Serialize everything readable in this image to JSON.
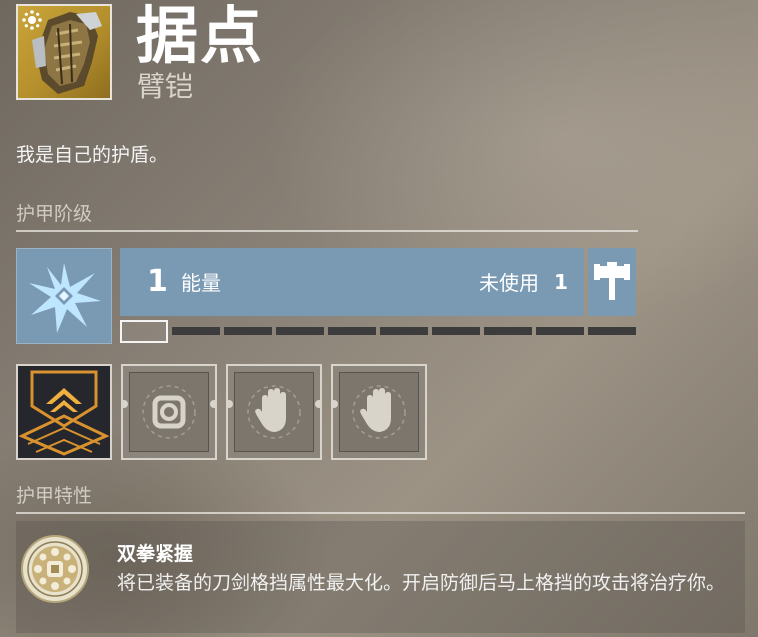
{
  "item": {
    "name": "据点",
    "type": "臂铠",
    "flavor_text": "我是自己的护盾。",
    "icon": "gauntlet-icon",
    "element_badge": "solar-icon",
    "tier_color": "#c9a53a"
  },
  "armor_tier": {
    "section_label": "护甲阶级",
    "energy_value": "1",
    "energy_label": "能量",
    "unused_label": "未使用",
    "unused_count": "1",
    "energy_capacity": 10,
    "energy_used": 1,
    "energy_icon": "arc-energy-icon",
    "class_item_icon": "hammer-icon",
    "energy_color": "#7a9ab4"
  },
  "mods": [
    {
      "icon": "armor-mod-chevron-icon",
      "state": "equipped"
    },
    {
      "icon": "gear-socket-icon",
      "state": "empty"
    },
    {
      "icon": "hand-socket-icon",
      "state": "empty"
    },
    {
      "icon": "hand-socket-icon",
      "state": "empty"
    }
  ],
  "armor_perks": {
    "section_label": "护甲特性",
    "perks": [
      {
        "icon": "perk-medallion-icon",
        "name": "双拳紧握",
        "description": "将已装备的刀剑格挡属性最大化。开启防御后马上格挡的攻击将治疗你。"
      }
    ]
  }
}
